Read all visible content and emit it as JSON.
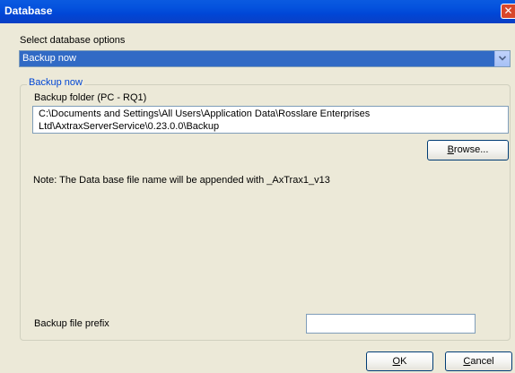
{
  "window": {
    "title": "Database",
    "close_glyph": "✕"
  },
  "options": {
    "label": "Select database options",
    "selected": "Backup now",
    "arrow_icon": "chevron-down-icon"
  },
  "group": {
    "legend": "Backup now",
    "folder_label": "Backup folder (PC - RQ1)",
    "folder_path_line1": "C:\\Documents and Settings\\All Users\\Application Data\\Rosslare Enterprises",
    "folder_path_line2": "Ltd\\AxtraxServerService\\0.23.0.0\\Backup",
    "browse_mnemonic": "B",
    "browse_rest": "rowse...",
    "note": "Note: The Data base file name will be appended with _AxTrax1_v13",
    "prefix_label": "Backup file prefix",
    "prefix_value": ""
  },
  "buttons": {
    "ok_mnemonic": "O",
    "ok_rest": "K",
    "cancel_mnemonic": "C",
    "cancel_rest": "ancel"
  },
  "colors": {
    "titlebar": "#0a52de",
    "selection": "#316ac5",
    "legend": "#0046d5",
    "background": "#ece9d8"
  }
}
